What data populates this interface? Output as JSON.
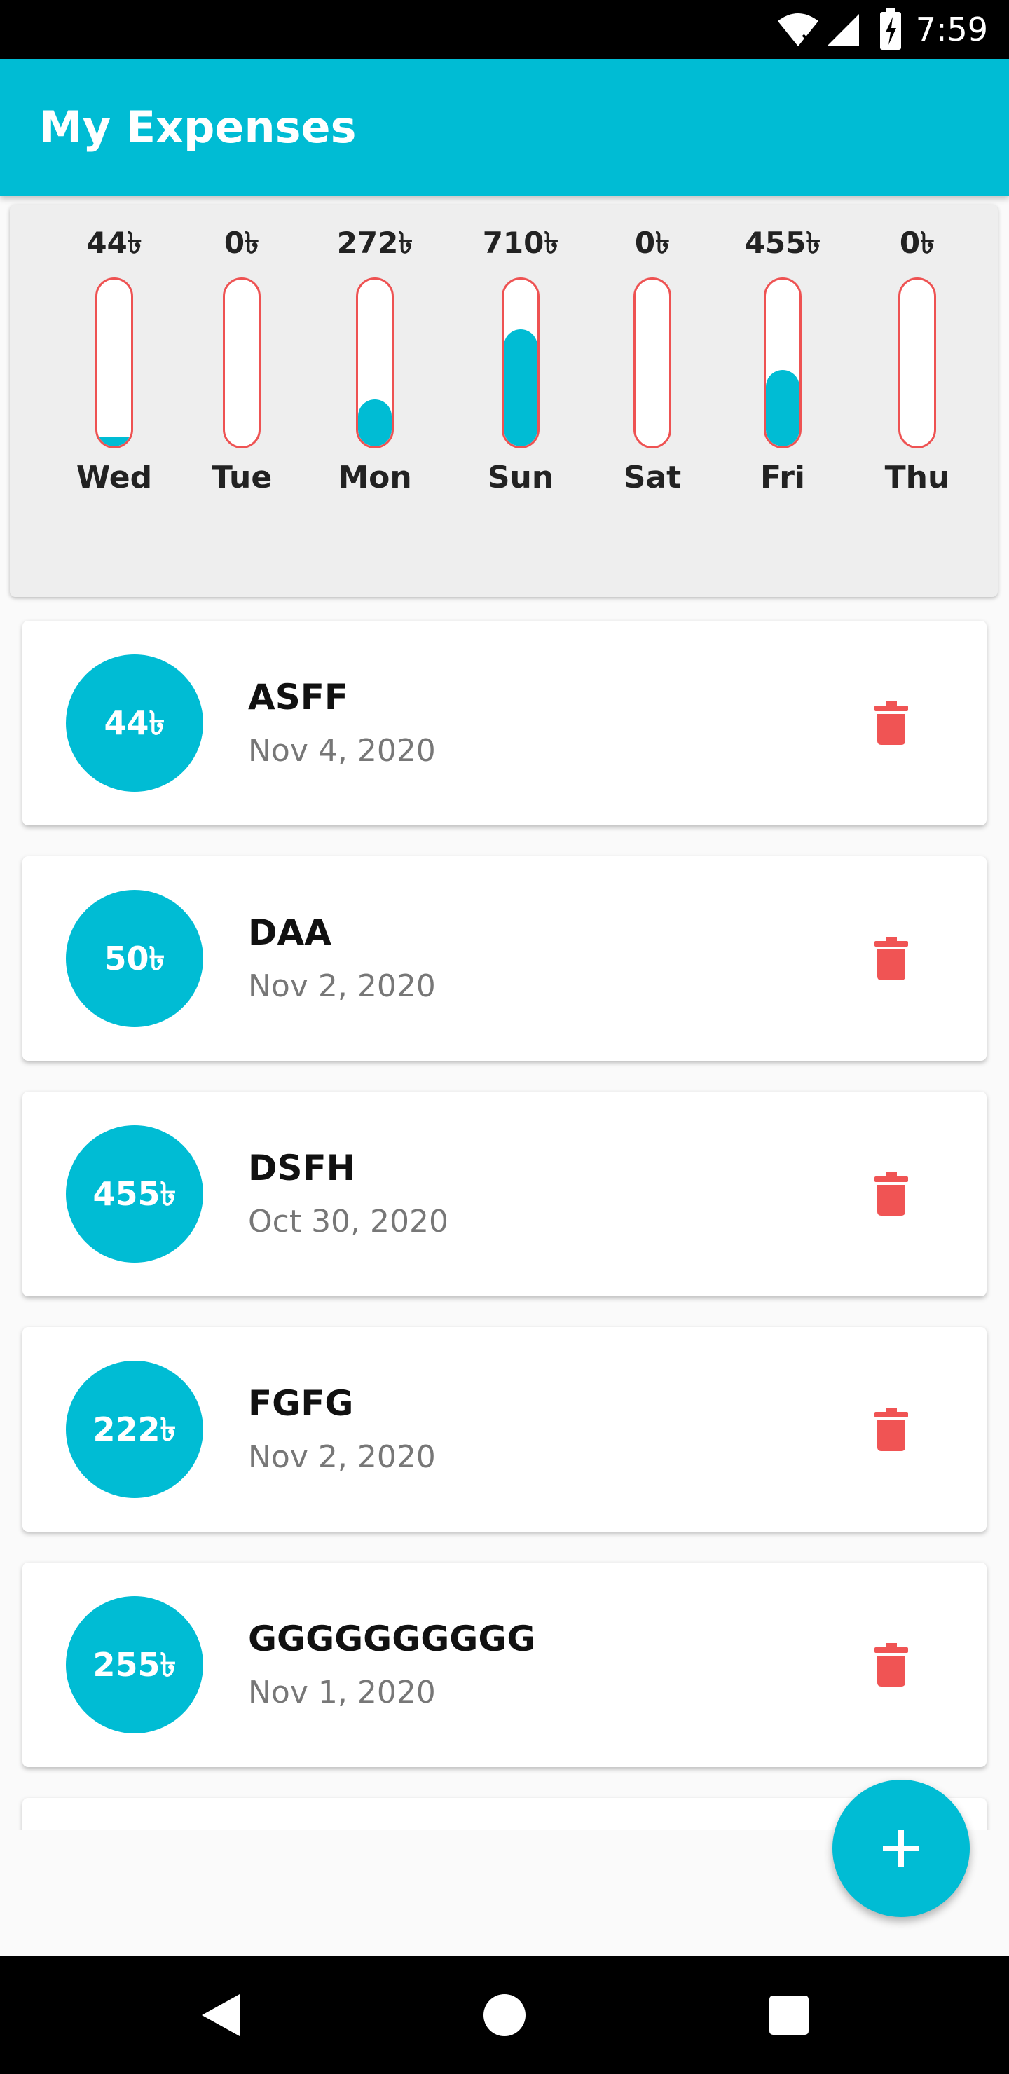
{
  "status_bar": {
    "time": "7:59",
    "icons": [
      "wifi-icon",
      "signal-icon",
      "battery-charging-icon"
    ]
  },
  "app_bar": {
    "title": "My Expenses"
  },
  "chart": {
    "currency": "৳",
    "bars": [
      {
        "day": "Wed",
        "amount": "44৳",
        "fill": 0.06
      },
      {
        "day": "Tue",
        "amount": "0৳",
        "fill": 0.0
      },
      {
        "day": "Mon",
        "amount": "272৳",
        "fill": 0.28
      },
      {
        "day": "Sun",
        "amount": "710৳",
        "fill": 0.7
      },
      {
        "day": "Sat",
        "amount": "0৳",
        "fill": 0.0
      },
      {
        "day": "Fri",
        "amount": "455৳",
        "fill": 0.46
      },
      {
        "day": "Thu",
        "amount": "0৳",
        "fill": 0.0
      }
    ],
    "colors": {
      "fill": "#00bcd4",
      "border": "#ee5252"
    }
  },
  "expenses": [
    {
      "amount": "44৳",
      "title": "ASFF",
      "date": "Nov 4, 2020"
    },
    {
      "amount": "50৳",
      "title": "DAA",
      "date": "Nov 2, 2020"
    },
    {
      "amount": "455৳",
      "title": "DSFH",
      "date": "Oct 30, 2020"
    },
    {
      "amount": "222৳",
      "title": "FGFG",
      "date": "Nov 2, 2020"
    },
    {
      "amount": "255৳",
      "title": "GGGGGGGGGG",
      "date": "Nov 1, 2020"
    }
  ],
  "fab": {
    "icon": "plus-icon"
  },
  "nav_bar": {
    "icons": [
      "back-icon",
      "home-icon",
      "recents-icon"
    ]
  },
  "colors": {
    "primary": "#00bcd4",
    "delete": "#f05454"
  }
}
